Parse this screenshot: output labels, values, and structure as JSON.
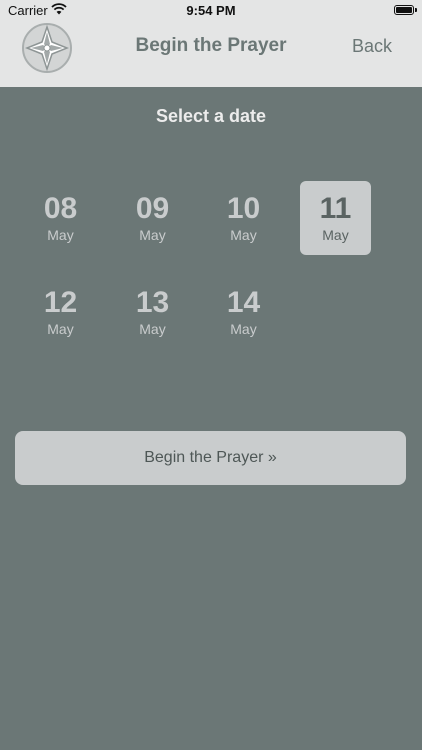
{
  "status_bar": {
    "carrier": "Carrier",
    "time": "9:54 PM"
  },
  "nav": {
    "title": "Begin the Prayer",
    "back_label": "Back",
    "logo_icon": "cross-emblem-icon"
  },
  "heading": "Select a date",
  "dates": [
    {
      "day": "08",
      "month": "May",
      "selected": false
    },
    {
      "day": "09",
      "month": "May",
      "selected": false
    },
    {
      "day": "10",
      "month": "May",
      "selected": false
    },
    {
      "day": "11",
      "month": "May",
      "selected": true
    },
    {
      "day": "12",
      "month": "May",
      "selected": false
    },
    {
      "day": "13",
      "month": "May",
      "selected": false
    },
    {
      "day": "14",
      "month": "May",
      "selected": false
    }
  ],
  "begin_button_label": "Begin the Prayer »",
  "colors": {
    "background": "#6b7776",
    "bar": "#e4e5e5",
    "selected": "#c9cccd"
  }
}
